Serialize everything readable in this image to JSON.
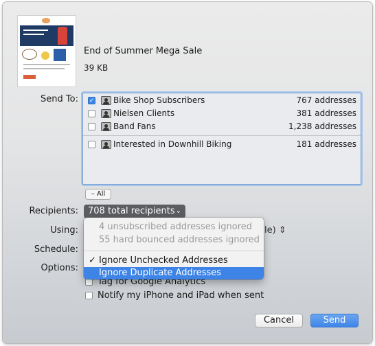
{
  "campaign": {
    "title": "End of Summer Mega Sale",
    "size": "39 KB",
    "thumbnail_headline": "Shop Now and Save Big!"
  },
  "labels": {
    "send_to": "Send To:",
    "recipients": "Recipients:",
    "using": "Using:",
    "schedule": "Schedule:",
    "options": "Options:"
  },
  "lists": [
    {
      "name": "Bike Shop Subscribers",
      "count": "767 addresses",
      "checked": true
    },
    {
      "name": "Nielsen Clients",
      "count": "381 addresses",
      "checked": false
    },
    {
      "name": "Band Fans",
      "count": "1,238 addresses",
      "checked": false
    },
    {
      "name": "Interested in Downhill Biking",
      "count": "181 addresses",
      "checked": false
    }
  ],
  "all_button": "– All",
  "recipients_popup": "708 total recipients",
  "using_tail": "le)",
  "menu": {
    "info_1": "4 unsubscribed addresses ignored",
    "info_2": "55 hard bounced addresses ignored",
    "item_1": "Ignore Unchecked Addresses",
    "item_1_checked": true,
    "item_2": "Ignore Duplicate Addresses",
    "item_2_highlighted": true
  },
  "options": {
    "analytics": "Tag for Google Analytics",
    "notify": "Notify my iPhone and iPad when sent"
  },
  "buttons": {
    "cancel": "Cancel",
    "send": "Send"
  },
  "colors": {
    "accent": "#3d84e6",
    "popup_bg": "#5b5d61",
    "send_button": "#3f85e8"
  }
}
